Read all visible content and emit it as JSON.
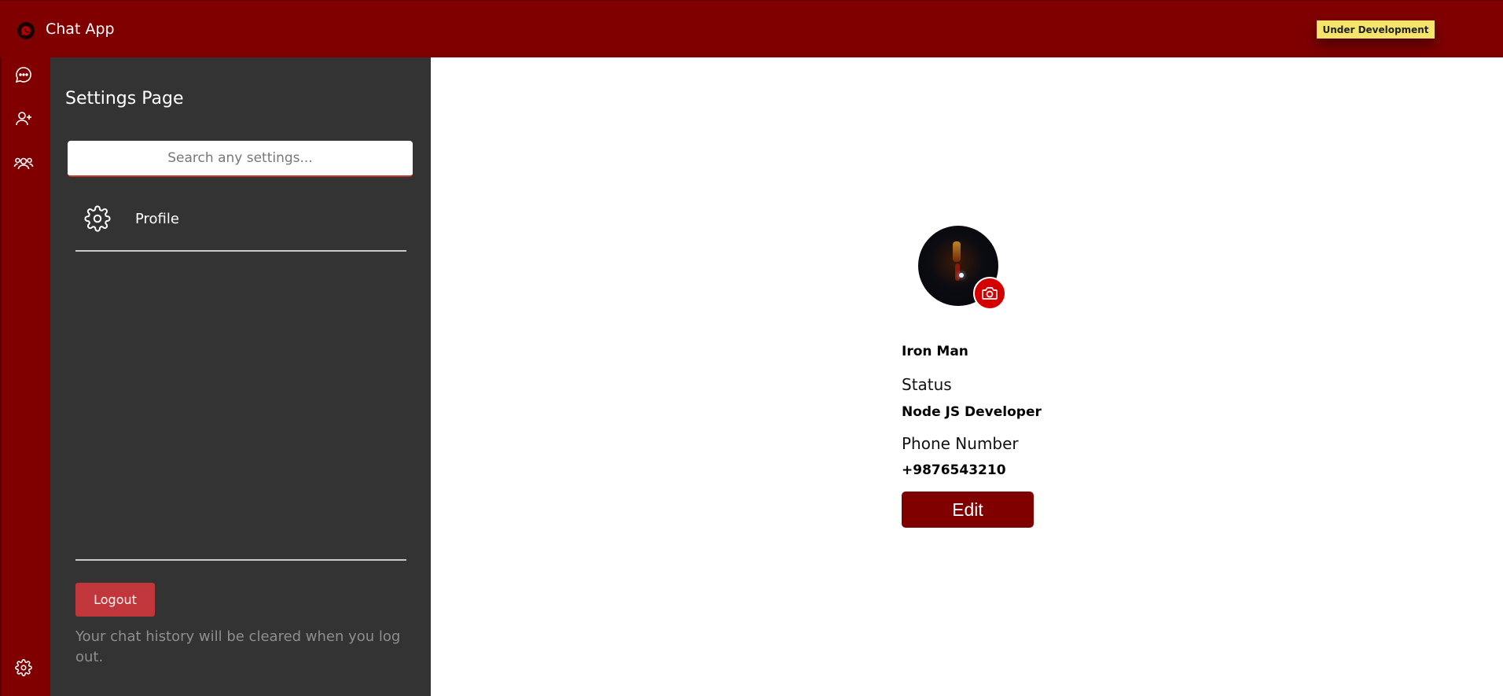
{
  "app": {
    "title": "Chat App",
    "badge": "Under Development",
    "accent": "#800000",
    "panel_bg": "#333333",
    "badge_color": "#f4e46a"
  },
  "rail": {
    "items": [
      {
        "icon": "chat-bubble-icon"
      },
      {
        "icon": "add-user-icon"
      },
      {
        "icon": "group-icon"
      },
      {
        "icon": "gear-icon"
      }
    ]
  },
  "settings": {
    "title": "Settings Page",
    "search_placeholder": "Search any settings...",
    "items": [
      {
        "label": "Profile",
        "icon": "gear-icon"
      }
    ],
    "logout_label": "Logout",
    "logout_note": "Your chat history will be cleared when you log out."
  },
  "profile": {
    "name": "Iron Man",
    "status_label": "Status",
    "status_value": "Node JS Developer",
    "phone_label": "Phone Number",
    "phone_value": "+9876543210",
    "edit_label": "Edit"
  }
}
